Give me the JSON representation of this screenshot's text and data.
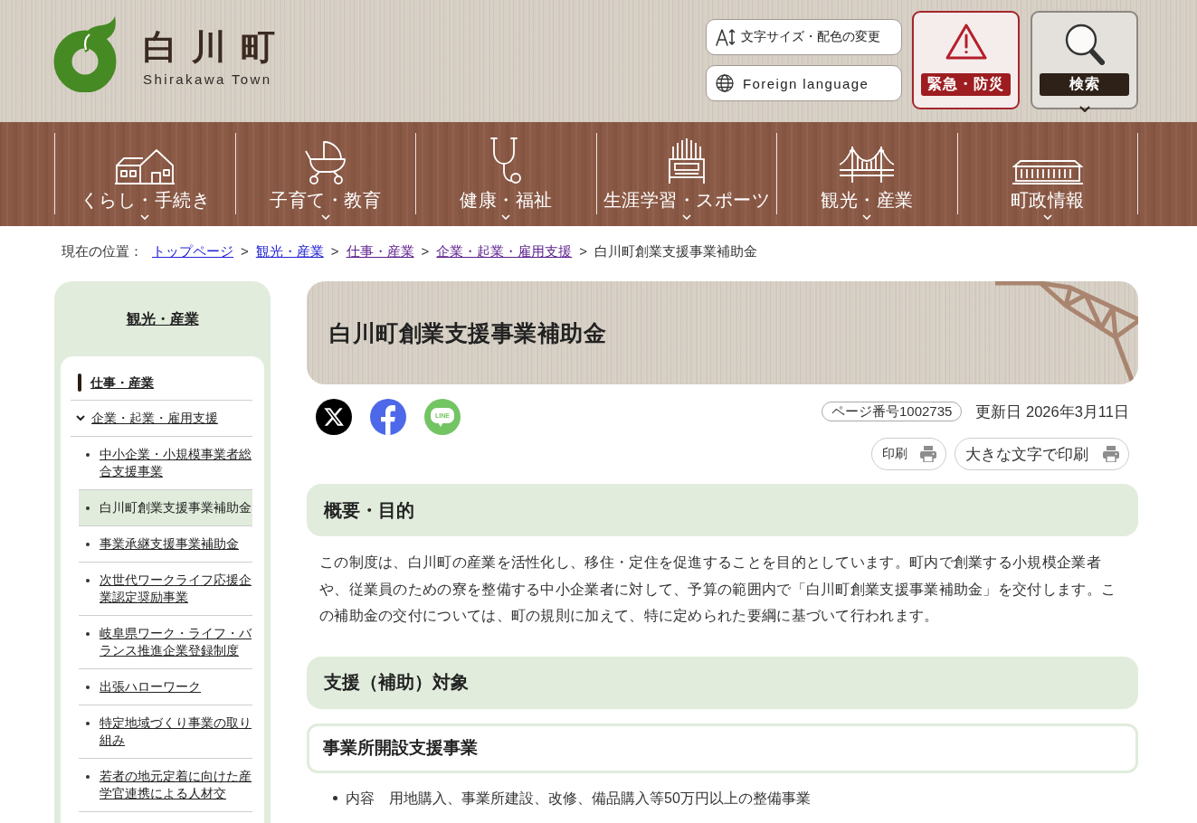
{
  "header": {
    "logo": {
      "title": "白川町",
      "subtitle": "Shirakawa Town"
    },
    "utility_buttons": [
      {
        "kind": "text-size",
        "label": "文字サイズ・配色の変更"
      },
      {
        "kind": "language",
        "label": "Foreign language"
      }
    ],
    "emergency_button": {
      "label": "緊急・防災"
    },
    "search_button": {
      "label": "検索"
    }
  },
  "nav": {
    "items": [
      {
        "label": "くらし・手続き"
      },
      {
        "label": "子育て・教育"
      },
      {
        "label": "健康・福祉"
      },
      {
        "label": "生涯学習・スポーツ"
      },
      {
        "label": "観光・産業"
      },
      {
        "label": "町政情報"
      }
    ]
  },
  "breadcrumb": {
    "label": "現在の位置：",
    "links": [
      {
        "text": "トップページ",
        "visited": false,
        "separator": ">"
      },
      {
        "text": "観光・産業",
        "visited": false,
        "separator": ">"
      },
      {
        "text": "仕事・産業",
        "visited": true,
        "separator": ">"
      },
      {
        "text": "企業・起業・雇用支援",
        "visited": true,
        "separator": ">"
      }
    ],
    "current": "白川町創業支援事業補助金"
  },
  "sidebar": {
    "title": "観光・産業",
    "items": [
      {
        "label": "仕事・産業",
        "children": [
          {
            "label": "企業・起業・雇用支援",
            "expanded": true,
            "children": [
              {
                "label": "中小企業・小規模事業者総合支援事業",
                "selected": false
              },
              {
                "label": "白川町創業支援事業補助金",
                "selected": true
              },
              {
                "label": "事業承継支援事業補助金",
                "selected": false
              },
              {
                "label": "次世代ワークライフ応援企業認定奨励事業",
                "selected": false
              },
              {
                "label": "岐阜県ワーク・ライフ・バランス推進企業登録制度",
                "selected": false
              },
              {
                "label": "出張ハローワーク",
                "selected": false
              },
              {
                "label": "特定地域づくり事業の取り組み",
                "selected": false
              },
              {
                "label": "若者の地元定着に向けた産学官連携による人材交",
                "selected": false
              }
            ]
          }
        ]
      }
    ]
  },
  "page": {
    "title": "白川町創業支援事業補助金",
    "share_buttons": [
      {
        "kind": "x"
      },
      {
        "kind": "facebook"
      },
      {
        "kind": "line",
        "text": "LINE"
      }
    ],
    "page_number": "ページ番号1002735",
    "updated": "更新日 2026年3月11日",
    "print_buttons": [
      {
        "kind": "normal",
        "label": "印刷"
      },
      {
        "kind": "large",
        "label": "大きな文字で印刷"
      }
    ],
    "sections": [
      {
        "kind": "heading",
        "text": "概要・目的"
      },
      {
        "kind": "paragraph",
        "text": "この制度は、白川町の産業を活性化し、移住・定住を促進することを目的としています。町内で創業する小規模企業者や、従業員のための寮を整備する中小企業者に対して、予算の範囲内で「白川町創業支援事業補助金」を交付します。この補助金の交付については、町の規則に加えて、特に定められた要綱に基づいて行われます。"
      },
      {
        "kind": "heading",
        "text": "支援（補助）対象"
      },
      {
        "kind": "subheading",
        "text": "事業所開設支援事業"
      },
      {
        "kind": "bullets",
        "items": [
          "内容　用地購入、事業所建設、改修、備品購入等50万円以上の整備事業"
        ]
      }
    ]
  }
}
